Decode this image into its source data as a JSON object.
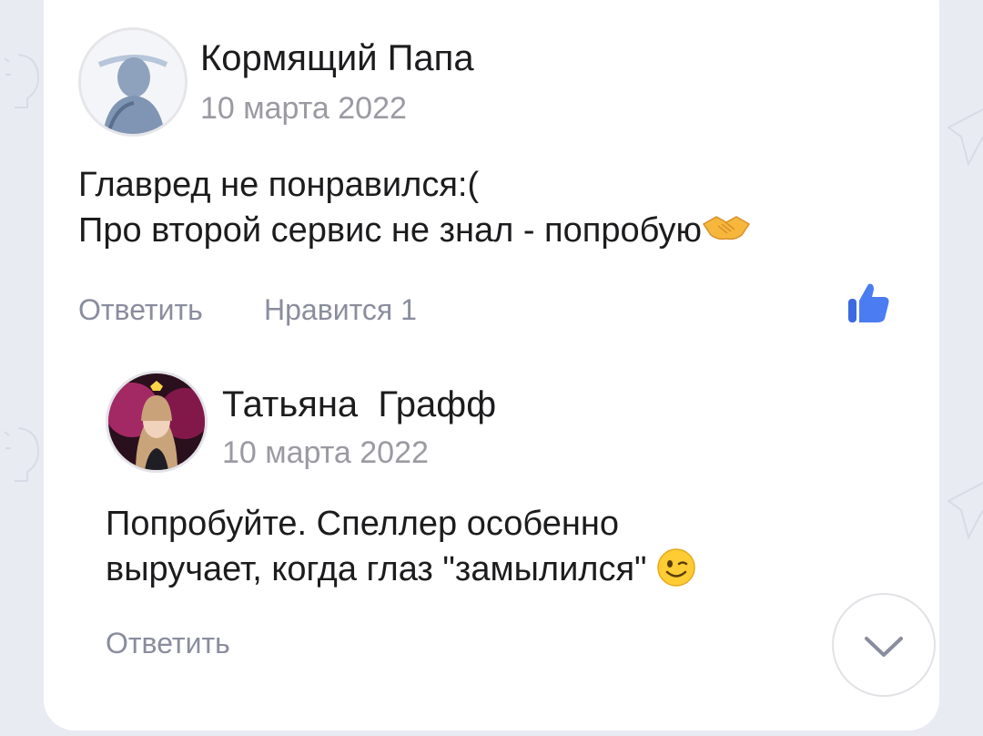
{
  "colors": {
    "background": "#e9ebf3",
    "card": "#ffffff",
    "text": "#1c1c1e",
    "secondary_text": "#9a9aa2",
    "action_text": "#8a8d9e",
    "like_accent": "#3d6ae0"
  },
  "comment": {
    "author": "Кормящий Папа",
    "date": "10 марта 2022",
    "text_lines": [
      "Главред не понравился:(",
      "Про второй сервис не знал - попробую"
    ],
    "emoji": "handshake-emoji",
    "reply_label": "Ответить",
    "likes_label": "Нравится 1",
    "like_icon": "thumbs-up-icon"
  },
  "reply": {
    "author": "Татьяна  Графф",
    "date": "10 марта 2022",
    "text_lines": [
      "Попробуйте. Спеллер особенно",
      "выручает, когда глаз \"замылился\""
    ],
    "emoji": "winking-face-emoji",
    "reply_label": "Ответить"
  },
  "scroll_button_icon": "chevron-down-icon"
}
